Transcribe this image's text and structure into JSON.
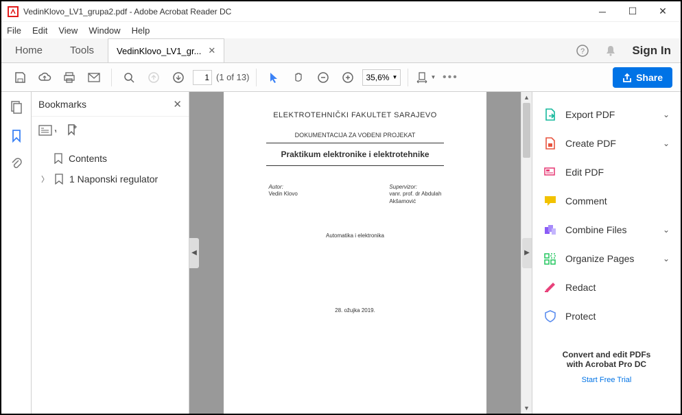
{
  "window": {
    "title": "VedinKlovo_LV1_grupa2.pdf - Adobe Acrobat Reader DC"
  },
  "menubar": [
    "File",
    "Edit",
    "View",
    "Window",
    "Help"
  ],
  "tabbar": {
    "home": "Home",
    "tools": "Tools",
    "doc": "VedinKlovo_LV1_gr...",
    "signin": "Sign In"
  },
  "toolbar": {
    "page_current": "1",
    "page_total": "(1 of 13)",
    "zoom": "35,6%",
    "share": "Share"
  },
  "bookmarks": {
    "title": "Bookmarks",
    "items": {
      "contents": "Contents",
      "ch1": "1 Naponski regulator"
    }
  },
  "doc": {
    "uni": "ELEKTROTEHNIČKI FAKULTET SARAJEVO",
    "subtitle": "DOKUMENTACIJA ZA VOĐENI PROJEKAT",
    "title": "Praktikum elektronike i elektrotehnike",
    "author_lbl": "Autor:",
    "author_name": "Vedin Klovo",
    "super_lbl": "Supervizor:",
    "super_name": "vanr. prof. dr Abdulah",
    "super_name2": "Akšamović",
    "dept": "Automatika i elektronika",
    "date": "28. ožujka 2019."
  },
  "rpanel": {
    "items": {
      "export": "Export PDF",
      "create": "Create PDF",
      "edit": "Edit PDF",
      "comment": "Comment",
      "combine": "Combine Files",
      "organize": "Organize Pages",
      "redact": "Redact",
      "protect": "Protect"
    },
    "promo1": "Convert and edit PDFs",
    "promo2": "with Acrobat Pro DC",
    "trial": "Start Free Trial"
  }
}
